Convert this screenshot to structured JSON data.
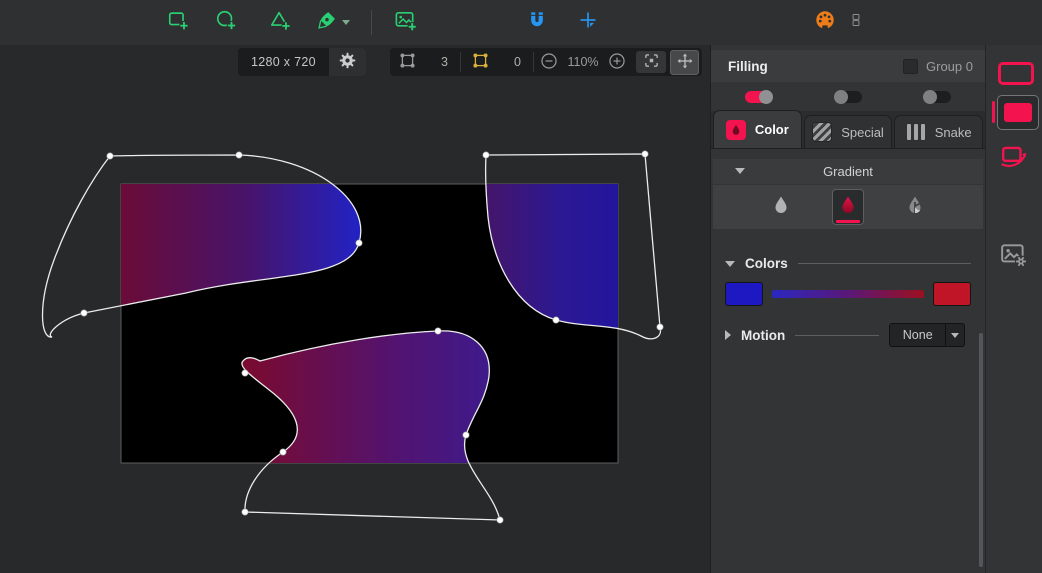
{
  "toolbar": {
    "tools": [
      {
        "icon": "add-rectangle-icon"
      },
      {
        "icon": "add-ellipse-icon"
      },
      {
        "icon": "add-triangle-icon"
      },
      {
        "icon": "pen-tool-icon",
        "has_dropdown": true
      },
      {
        "icon": "add-image-icon"
      },
      {
        "icon": "snapping-magnet-icon"
      },
      {
        "icon": "add-guide-crosshair-icon"
      },
      {
        "icon": "color-palette-icon"
      },
      {
        "icon": "panels-layout-icon"
      }
    ]
  },
  "canvas": {
    "size_label": "1280 x 720",
    "nodes_total": "3",
    "nodes_selected": "0",
    "zoom_level": "110%",
    "artboard_color": "#000000",
    "shape_gradient_start": "#6f0a31",
    "shape_gradient_end": "#2023c8"
  },
  "filling_panel": {
    "title": "Filling",
    "group_checkbox_label": "Group 0",
    "toggles": [
      {
        "state": "on"
      },
      {
        "state": "off"
      },
      {
        "state": "off"
      }
    ],
    "tabs": [
      {
        "label": "Color",
        "icon": "color-droplet-icon",
        "active": true
      },
      {
        "label": "Special",
        "icon": "hatch-pattern-icon",
        "active": false
      },
      {
        "label": "Snake",
        "icon": "vertical-bars-icon",
        "active": false
      }
    ],
    "gradient_section": {
      "title": "Gradient",
      "options": [
        {
          "icon": "solid-droplet-icon",
          "selected": false
        },
        {
          "icon": "gradient-droplet-icon",
          "selected": true
        },
        {
          "icon": "multi-droplet-icon",
          "selected": false
        }
      ]
    },
    "colors_section": {
      "title": "Colors",
      "start_color": "#1d18c2",
      "end_color": "#c01527",
      "bar_css": "linear-gradient(90deg,#2a28c0,#5a1878,#9c1020)"
    },
    "motion_section": {
      "title": "Motion",
      "value": "None"
    }
  },
  "right_sidebar": {
    "items": [
      {
        "icon": "stroke-rectangle-icon",
        "selected": false
      },
      {
        "icon": "fill-rectangle-icon",
        "selected": true
      },
      {
        "icon": "shape-motion-icon",
        "selected": false
      },
      {
        "icon": "image-settings-icon",
        "selected": false
      }
    ]
  },
  "accent_colors": {
    "green": "#29cf72",
    "blue": "#2596f3",
    "orange": "#ee7d19",
    "red": "#f2134f",
    "yellow": "#d9b13b"
  }
}
